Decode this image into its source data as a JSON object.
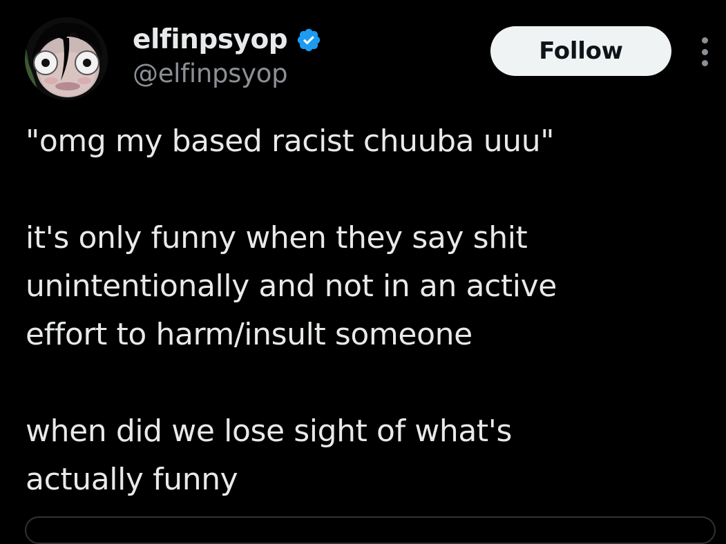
{
  "author": {
    "display_name": "elfinpsyop",
    "handle": "@elfinpsyop",
    "verified": true,
    "avatar_icon": "creepy-face-avatar"
  },
  "actions": {
    "follow_label": "Follow",
    "more_icon": "more-vertical-icon"
  },
  "tweet": {
    "line1": "\"omg my based racist chuuba uuu\"",
    "para2_line1": "it's only funny when they say shit",
    "para2_line2": "unintentionally and not in an active",
    "para2_line3": "effort to harm/insult someone",
    "para3_line1": "when did we lose sight of what's",
    "para3_line2": "actually funny"
  },
  "colors": {
    "background": "#000000",
    "text_primary": "#e7e9ea",
    "text_secondary": "#8b9096",
    "verified_blue": "#1d9bf0",
    "follow_bg": "#eff3f4",
    "follow_text": "#0f1419",
    "border": "#2f3336"
  }
}
